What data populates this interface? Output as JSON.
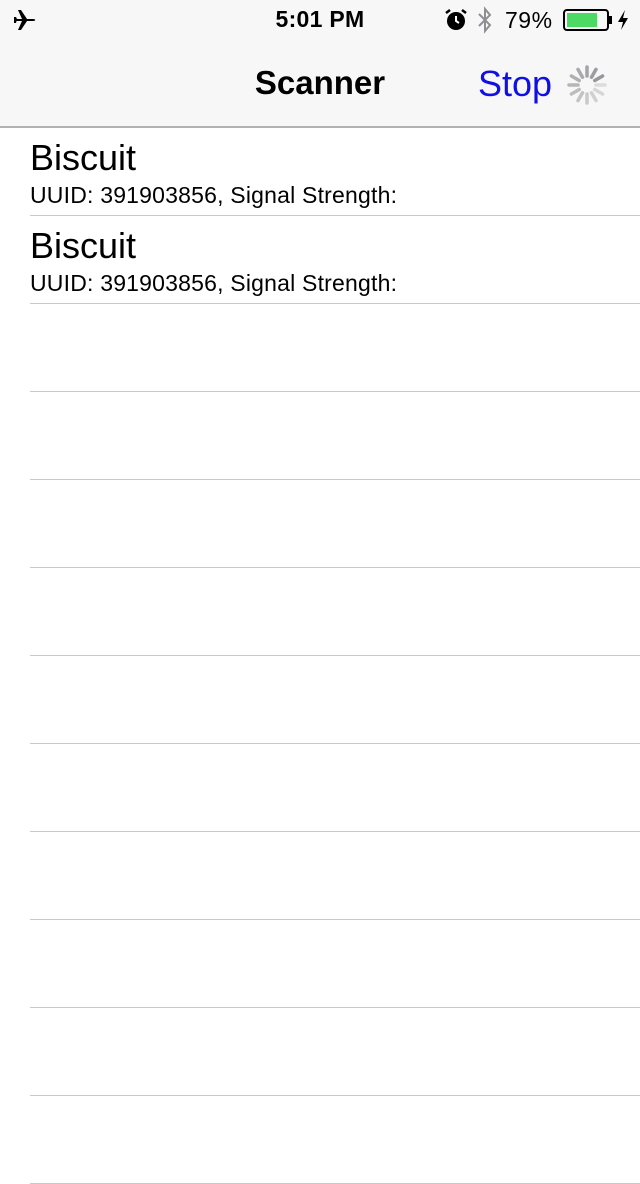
{
  "status_bar": {
    "time": "5:01 PM",
    "battery_percent": "79%",
    "battery_level": 0.79,
    "icons": [
      "airplane-icon",
      "alarm-icon",
      "bluetooth-icon",
      "battery-icon",
      "charging-icon"
    ],
    "battery_color": "#4cd964"
  },
  "nav": {
    "title": "Scanner",
    "stop_label": "Stop",
    "accent_color": "#1010e6",
    "spinner_icon": "activity-spinner-icon"
  },
  "list": {
    "items": [
      {
        "title": "Biscuit",
        "subtitle": "UUID: 391903856, Signal Strength:"
      },
      {
        "title": "Biscuit",
        "subtitle": "UUID: 391903856, Signal Strength:"
      }
    ],
    "empty_rows": 10
  }
}
